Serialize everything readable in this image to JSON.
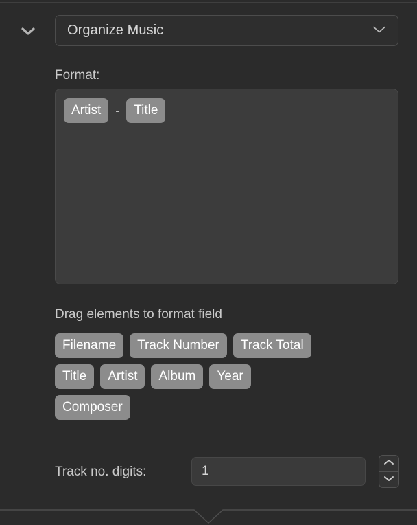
{
  "window": {
    "title": "Organize Music"
  },
  "header": {
    "disclosure_icon": "chevron-down-icon",
    "disclosure_expanded": true,
    "popup": {
      "selected": "Organize Music",
      "chevron_icon": "chevron-down-icon",
      "options": [
        "Organize Music"
      ]
    }
  },
  "format_section": {
    "label": "Format:",
    "tokens": [
      {
        "type": "token",
        "label": "Artist"
      },
      {
        "type": "separator",
        "label": "-"
      },
      {
        "type": "token",
        "label": "Title"
      }
    ]
  },
  "palette_section": {
    "hint": "Drag elements to format field",
    "rows": [
      [
        "Filename",
        "Track Number",
        "Track Total"
      ],
      [
        "Title",
        "Artist",
        "Album",
        "Year"
      ],
      [
        "Composer"
      ]
    ]
  },
  "digits_section": {
    "label": "Track no. digits:",
    "value": "1",
    "placeholder": "",
    "stepper": {
      "increment_icon": "chevron-up-icon",
      "decrement_icon": "chevron-down-icon"
    }
  },
  "colors": {
    "background": "#2b2b2b",
    "field_fill": "#3c3c3c",
    "pill_fill": "#8c8c8c",
    "pill_text": "#ffffff",
    "label_text": "#c9c9c9",
    "border": "#4a4a4a"
  }
}
